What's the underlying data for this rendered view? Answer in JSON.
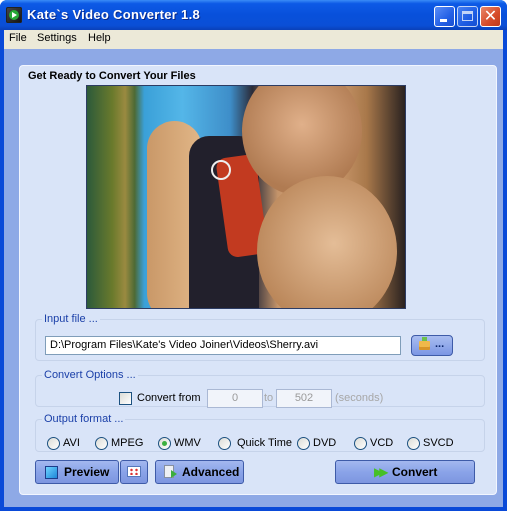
{
  "window": {
    "title": "Kate`s Video Converter 1.8",
    "app_icon": "video-converter-app-icon",
    "controls": {
      "minimize": "minimize-icon",
      "maximize": "maximize-icon",
      "close": "close-icon",
      "close_glyph": "✕"
    }
  },
  "menu": {
    "items": [
      {
        "label": "File"
      },
      {
        "label": "Settings"
      },
      {
        "label": "Help"
      }
    ]
  },
  "main": {
    "heading": "Get Ready to Convert Your Files",
    "preview_image": "video-frame-preview"
  },
  "input_file": {
    "legend": "Input file ...",
    "path": "D:\\Program Files\\Kate's Video Joiner\\Videos\\Sherry.avi",
    "browse_label": "..."
  },
  "convert_options": {
    "legend": "Convert Options ...",
    "checkbox_label": "Convert from",
    "checked": false,
    "from_value": "0",
    "to_label": "to",
    "to_value": "502",
    "unit_label": "(seconds)"
  },
  "output_format": {
    "legend": "Output format ...",
    "selected": "WMV",
    "options": [
      {
        "label": "AVI",
        "selected": false
      },
      {
        "label": "MPEG",
        "selected": false
      },
      {
        "label": "WMV",
        "selected": true
      },
      {
        "label": "Quick Time",
        "selected": false
      },
      {
        "label": "DVD",
        "selected": false
      },
      {
        "label": "VCD",
        "selected": false
      },
      {
        "label": "SVCD",
        "selected": false
      }
    ]
  },
  "buttons": {
    "preview": "Preview",
    "advanced": "Advanced",
    "convert": "Convert",
    "convert_glyph": "▶▶"
  }
}
